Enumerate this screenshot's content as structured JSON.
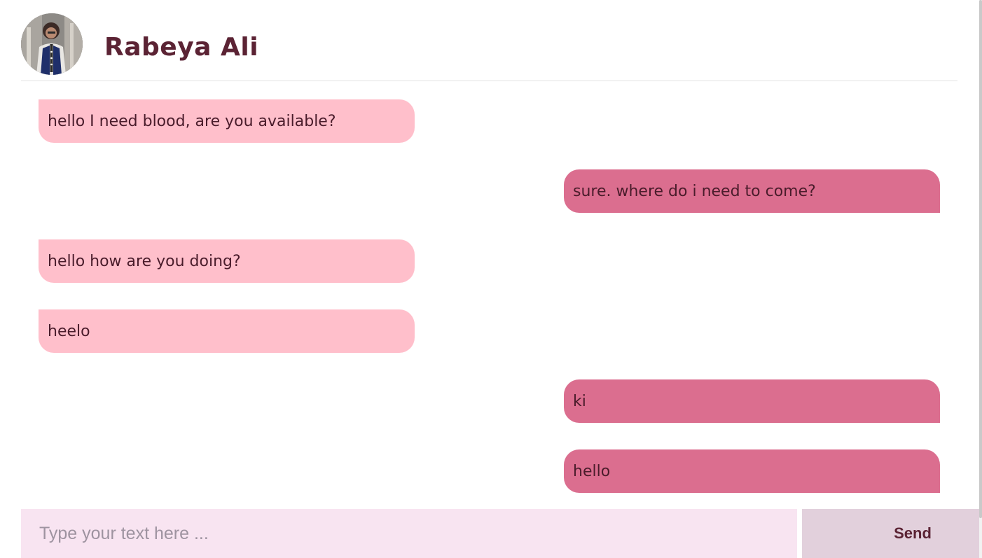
{
  "header": {
    "user_name": "Rabeya Ali",
    "avatar_icon": "profile-photo"
  },
  "messages": [
    {
      "direction": "received",
      "text": "hello I need blood, are you available?"
    },
    {
      "direction": "sent",
      "text": "sure. where do i need to come?"
    },
    {
      "direction": "received",
      "text": "hello how are you doing?"
    },
    {
      "direction": "received",
      "text": "heelo"
    },
    {
      "direction": "sent",
      "text": "ki"
    },
    {
      "direction": "sent",
      "text": "hello"
    }
  ],
  "composer": {
    "placeholder": "Type your text here ...",
    "value": "",
    "send_label": "Send"
  },
  "colors": {
    "received_bubble": "#ffbfcb",
    "sent_bubble": "#db6e8f",
    "name_text": "#5b2334",
    "input_bg": "#f8e4f1",
    "send_bg": "#e2d0dc"
  }
}
